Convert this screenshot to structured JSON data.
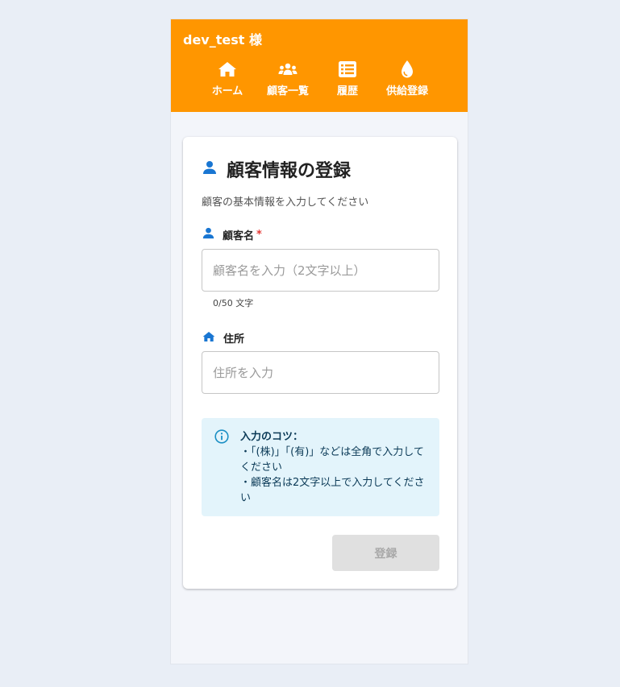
{
  "header": {
    "user_name": "dev_test 様",
    "nav": [
      {
        "label": "ホーム",
        "icon": "home-icon"
      },
      {
        "label": "顧客一覧",
        "icon": "users-icon"
      },
      {
        "label": "履歴",
        "icon": "list-icon"
      },
      {
        "label": "供給登録",
        "icon": "drop-icon"
      }
    ]
  },
  "form": {
    "title": "顧客情報の登録",
    "subtitle": "顧客の基本情報を入力してください",
    "name_field": {
      "label": "顧客名",
      "required_mark": "*",
      "placeholder": "顧客名を入力（2文字以上）",
      "value": "",
      "counter": "0/50 文字"
    },
    "address_field": {
      "label": "住所",
      "placeholder": "住所を入力",
      "value": ""
    },
    "tips": {
      "heading": "入力のコツ：",
      "line1": "・「(株)」「(有)」などは全角で入力してください",
      "line2": "・顧客名は2文字以上で入力してください"
    },
    "submit_label": "登録"
  },
  "colors": {
    "header_bg": "#ff9600",
    "accent_blue": "#1976d2",
    "tips_bg": "#e3f4fb",
    "required": "#e53935"
  }
}
